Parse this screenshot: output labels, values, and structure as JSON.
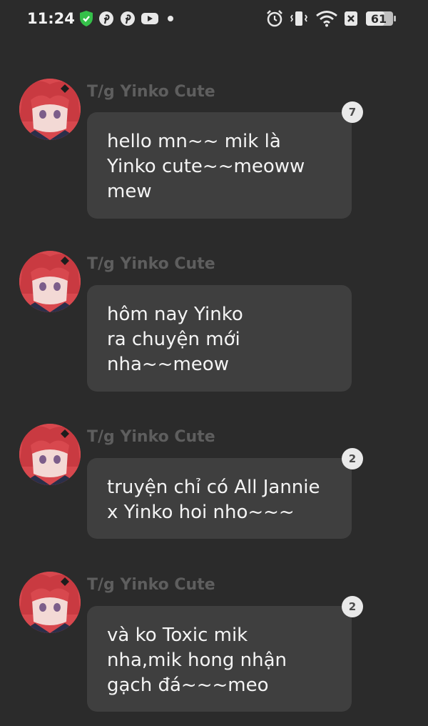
{
  "status_bar": {
    "time": "11:24",
    "battery": "61",
    "left_icons": [
      "shield-icon",
      "pinterest-icon",
      "pinterest-icon",
      "youtube-icon",
      "dot-icon"
    ],
    "right_icons": [
      "alarm-icon",
      "vibrate-icon",
      "wifi-icon",
      "no-sim-icon",
      "battery-icon"
    ]
  },
  "messages": [
    {
      "author": "T/g Yinko Cute",
      "lines": [
        "hello mn~~ mik là",
        "Yinko cute~~meoww",
        "mew"
      ],
      "badge": "7"
    },
    {
      "author": "T/g Yinko Cute",
      "lines": [
        "hôm nay Yinko",
        "ra chuyện mới",
        "nha~~meow"
      ],
      "badge": ""
    },
    {
      "author": "T/g Yinko Cute",
      "lines": [
        "truyện chỉ có All Jannie",
        "x Yinko hoi nho~~~"
      ],
      "badge": "2"
    },
    {
      "author": "T/g Yinko Cute",
      "lines": [
        "và ko Toxic mik",
        "nha,mik hong nhận",
        "gạch đá~~~meo"
      ],
      "badge": "2"
    }
  ],
  "colors": {
    "background": "#2b2b2b",
    "bubble": "#3f3f3f",
    "author": "#5e5e5e",
    "badge": "#e9e9e9",
    "avatar_hair": "#d6474c"
  }
}
